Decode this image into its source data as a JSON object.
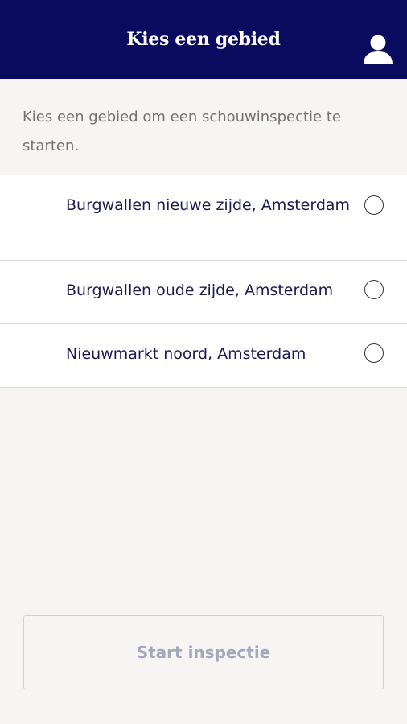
{
  "header": {
    "title": "Kies een gebied",
    "user_icon": "user-icon"
  },
  "intro_text": "Kies een gebied om een schouwinspectie te starten.",
  "areas": [
    {
      "label": "Burgwallen nieuwe zijde, Amsterdam",
      "selected": false
    },
    {
      "label": "Burgwallen oude zijde, Amsterdam",
      "selected": false
    },
    {
      "label": "Nieuwmarkt noord, Amsterdam",
      "selected": false
    }
  ],
  "start_button": {
    "label": "Start inspectie",
    "enabled": false
  },
  "colors": {
    "header_bg": "#0a0b5e",
    "page_bg": "#f6f5f3",
    "item_text": "#1a1b52",
    "disabled_text": "#a3a8bd"
  }
}
